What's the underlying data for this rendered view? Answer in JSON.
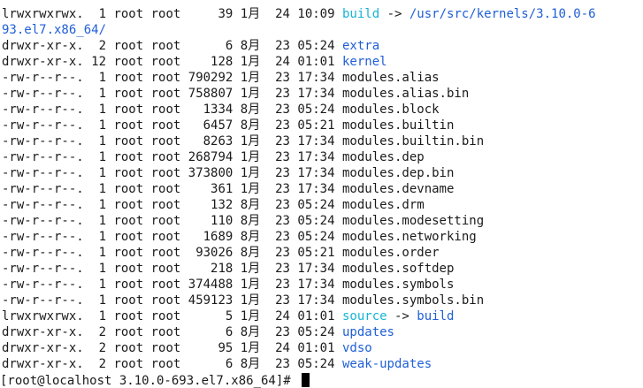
{
  "colors": {
    "background": "#ffffff",
    "text": "#1a1a1a",
    "directory": "#1f5fd6",
    "symlink": "#17b4d4"
  },
  "terminal": {
    "listing": [
      {
        "perm": "lrwxrwxrwx.",
        "links": "1",
        "owner": "root",
        "group": "root",
        "size": "39",
        "month": "1月",
        "day": "24",
        "time": "10:09",
        "name": "build",
        "kind": "link",
        "arrow": "->",
        "target": "/usr/src/kernels/3.10.0-6",
        "target_kind": "dir"
      },
      {
        "wrap": "93.el7.x86_64/"
      },
      {
        "perm": "drwxr-xr-x.",
        "links": "2",
        "owner": "root",
        "group": "root",
        "size": "6",
        "month": "8月",
        "day": "23",
        "time": "05:24",
        "name": "extra",
        "kind": "dir"
      },
      {
        "perm": "drwxr-xr-x.",
        "links": "12",
        "owner": "root",
        "group": "root",
        "size": "128",
        "month": "1月",
        "day": "24",
        "time": "01:01",
        "name": "kernel",
        "kind": "dir"
      },
      {
        "perm": "-rw-r--r--.",
        "links": "1",
        "owner": "root",
        "group": "root",
        "size": "790292",
        "month": "1月",
        "day": "23",
        "time": "17:34",
        "name": "modules.alias",
        "kind": "file"
      },
      {
        "perm": "-rw-r--r--.",
        "links": "1",
        "owner": "root",
        "group": "root",
        "size": "758807",
        "month": "1月",
        "day": "23",
        "time": "17:34",
        "name": "modules.alias.bin",
        "kind": "file"
      },
      {
        "perm": "-rw-r--r--.",
        "links": "1",
        "owner": "root",
        "group": "root",
        "size": "1334",
        "month": "8月",
        "day": "23",
        "time": "05:24",
        "name": "modules.block",
        "kind": "file"
      },
      {
        "perm": "-rw-r--r--.",
        "links": "1",
        "owner": "root",
        "group": "root",
        "size": "6457",
        "month": "8月",
        "day": "23",
        "time": "05:21",
        "name": "modules.builtin",
        "kind": "file"
      },
      {
        "perm": "-rw-r--r--.",
        "links": "1",
        "owner": "root",
        "group": "root",
        "size": "8263",
        "month": "1月",
        "day": "23",
        "time": "17:34",
        "name": "modules.builtin.bin",
        "kind": "file"
      },
      {
        "perm": "-rw-r--r--.",
        "links": "1",
        "owner": "root",
        "group": "root",
        "size": "268794",
        "month": "1月",
        "day": "23",
        "time": "17:34",
        "name": "modules.dep",
        "kind": "file"
      },
      {
        "perm": "-rw-r--r--.",
        "links": "1",
        "owner": "root",
        "group": "root",
        "size": "373800",
        "month": "1月",
        "day": "23",
        "time": "17:34",
        "name": "modules.dep.bin",
        "kind": "file"
      },
      {
        "perm": "-rw-r--r--.",
        "links": "1",
        "owner": "root",
        "group": "root",
        "size": "361",
        "month": "1月",
        "day": "23",
        "time": "17:34",
        "name": "modules.devname",
        "kind": "file"
      },
      {
        "perm": "-rw-r--r--.",
        "links": "1",
        "owner": "root",
        "group": "root",
        "size": "132",
        "month": "8月",
        "day": "23",
        "time": "05:24",
        "name": "modules.drm",
        "kind": "file"
      },
      {
        "perm": "-rw-r--r--.",
        "links": "1",
        "owner": "root",
        "group": "root",
        "size": "110",
        "month": "8月",
        "day": "23",
        "time": "05:24",
        "name": "modules.modesetting",
        "kind": "file"
      },
      {
        "perm": "-rw-r--r--.",
        "links": "1",
        "owner": "root",
        "group": "root",
        "size": "1689",
        "month": "8月",
        "day": "23",
        "time": "05:24",
        "name": "modules.networking",
        "kind": "file"
      },
      {
        "perm": "-rw-r--r--.",
        "links": "1",
        "owner": "root",
        "group": "root",
        "size": "93026",
        "month": "8月",
        "day": "23",
        "time": "05:21",
        "name": "modules.order",
        "kind": "file"
      },
      {
        "perm": "-rw-r--r--.",
        "links": "1",
        "owner": "root",
        "group": "root",
        "size": "218",
        "month": "1月",
        "day": "23",
        "time": "17:34",
        "name": "modules.softdep",
        "kind": "file"
      },
      {
        "perm": "-rw-r--r--.",
        "links": "1",
        "owner": "root",
        "group": "root",
        "size": "374488",
        "month": "1月",
        "day": "23",
        "time": "17:34",
        "name": "modules.symbols",
        "kind": "file"
      },
      {
        "perm": "-rw-r--r--.",
        "links": "1",
        "owner": "root",
        "group": "root",
        "size": "459123",
        "month": "1月",
        "day": "23",
        "time": "17:34",
        "name": "modules.symbols.bin",
        "kind": "file"
      },
      {
        "perm": "lrwxrwxrwx.",
        "links": "1",
        "owner": "root",
        "group": "root",
        "size": "5",
        "month": "1月",
        "day": "24",
        "time": "01:01",
        "name": "source",
        "kind": "link",
        "arrow": "->",
        "target": "build",
        "target_kind": "dir"
      },
      {
        "perm": "drwxr-xr-x.",
        "links": "2",
        "owner": "root",
        "group": "root",
        "size": "6",
        "month": "8月",
        "day": "23",
        "time": "05:24",
        "name": "updates",
        "kind": "dir"
      },
      {
        "perm": "drwxr-xr-x.",
        "links": "2",
        "owner": "root",
        "group": "root",
        "size": "95",
        "month": "1月",
        "day": "24",
        "time": "01:01",
        "name": "vdso",
        "kind": "dir"
      },
      {
        "perm": "drwxr-xr-x.",
        "links": "2",
        "owner": "root",
        "group": "root",
        "size": "6",
        "month": "8月",
        "day": "23",
        "time": "05:24",
        "name": "weak-updates",
        "kind": "dir"
      }
    ],
    "prompt": "[root@localhost 3.10.0-693.el7.x86_64]# "
  }
}
